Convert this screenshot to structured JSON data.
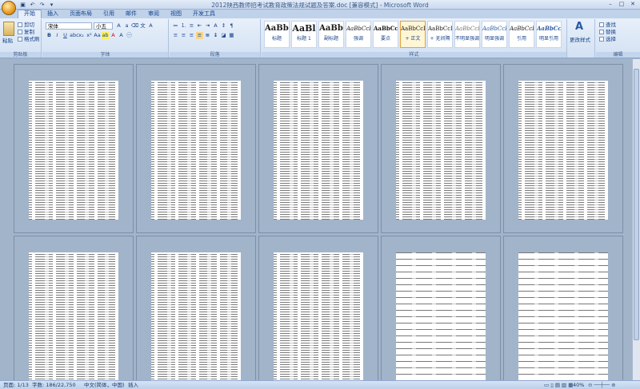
{
  "window": {
    "title": "2012陕西教师招考试教育政策法规试题及答案.doc [兼容模式] - Microsoft Word"
  },
  "tabs": [
    "开始",
    "插入",
    "页面布局",
    "引用",
    "邮件",
    "审阅",
    "视图",
    "开发工具"
  ],
  "clipboard": {
    "paste": "粘贴",
    "cut": "剪切",
    "copy": "复制",
    "format_painter": "格式刷",
    "label": "剪贴板"
  },
  "font": {
    "name": "宋体",
    "size": "小五",
    "label": "字体"
  },
  "paragraph": {
    "label": "段落"
  },
  "styles": {
    "label": "样式",
    "items": [
      {
        "preview": "AaBbC",
        "name": "标题"
      },
      {
        "preview": "AaBl",
        "name": "标题 1"
      },
      {
        "preview": "AaBb",
        "name": "副标题"
      },
      {
        "preview": "AaBbCcD",
        "name": "强调"
      },
      {
        "preview": "AaBbCcD",
        "name": "要点"
      },
      {
        "preview": "AaBbCcDc",
        "name": "+ 正文"
      },
      {
        "preview": "AaBbCcDc",
        "name": "+ 无间隔"
      },
      {
        "preview": "AaBbCcDc",
        "name": "不明显强调"
      },
      {
        "preview": "AaBbCcDc",
        "name": "明显强调"
      },
      {
        "preview": "AaBbCcDc",
        "name": "引用"
      },
      {
        "preview": "AaBbCcDc",
        "name": "明显引用"
      }
    ],
    "change": "更改样式"
  },
  "editing": {
    "find": "查找",
    "replace": "替换",
    "select": "选择",
    "label": "编辑"
  },
  "status": {
    "page": "页面: 1/13",
    "words": "字数: 186/22,750",
    "lang": "中文(简体，中国)",
    "mode": "插入",
    "zoom": "40%"
  }
}
